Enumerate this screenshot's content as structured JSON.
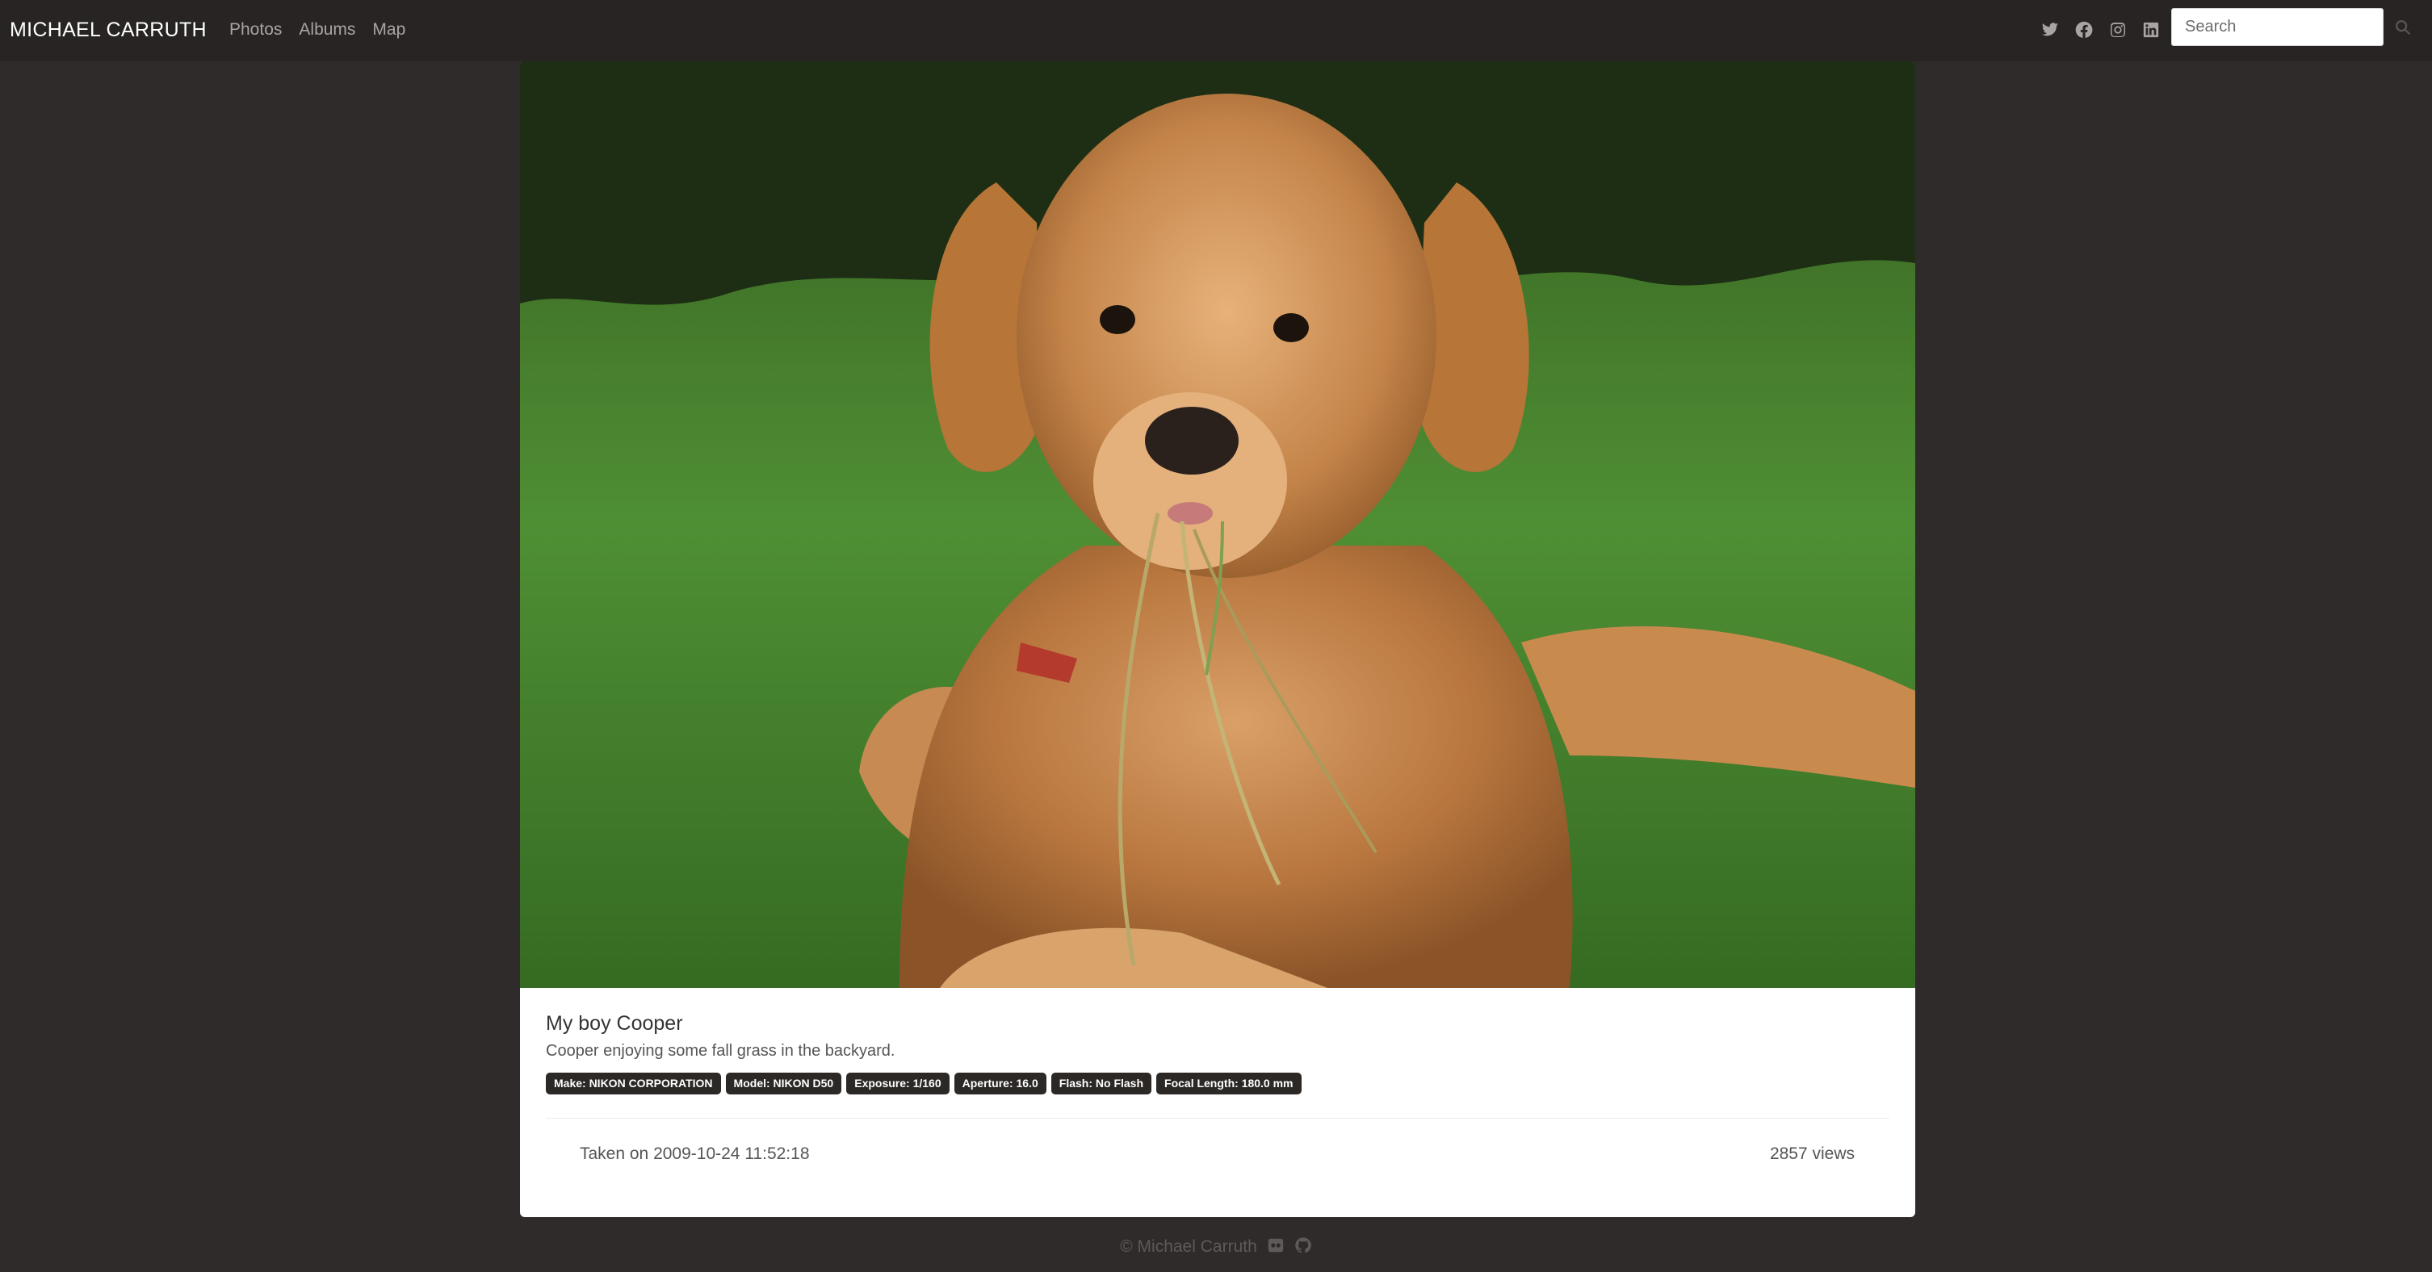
{
  "navbar": {
    "brand": "MICHAEL CARRUTH",
    "links": [
      "Photos",
      "Albums",
      "Map"
    ],
    "social_icons": [
      "twitter-icon",
      "facebook-icon",
      "instagram-icon",
      "linkedin-icon"
    ],
    "search": {
      "placeholder": "Search",
      "value": ""
    },
    "search_icon": "search-icon"
  },
  "photo": {
    "title": "My boy Cooper",
    "description": "Cooper enjoying some fall grass in the backyard.",
    "exif_badges": [
      "Make: NIKON CORPORATION",
      "Model: NIKON D50",
      "Exposure: 1/160",
      "Aperture: 16.0",
      "Flash: No Flash",
      "Focal Length: 180.0 mm"
    ],
    "taken": "Taken on 2009-10-24 11:52:18",
    "views": "2857 views"
  },
  "footer": {
    "copyright": "© Michael Carruth",
    "icons": [
      "flickr-icon",
      "github-icon"
    ]
  },
  "colors": {
    "page_bg": "#2f2b2a",
    "navbar_bg": "#272423",
    "card_bg": "#ffffff",
    "badge_bg": "#2c2826",
    "muted_text": "#a8a4a2"
  }
}
